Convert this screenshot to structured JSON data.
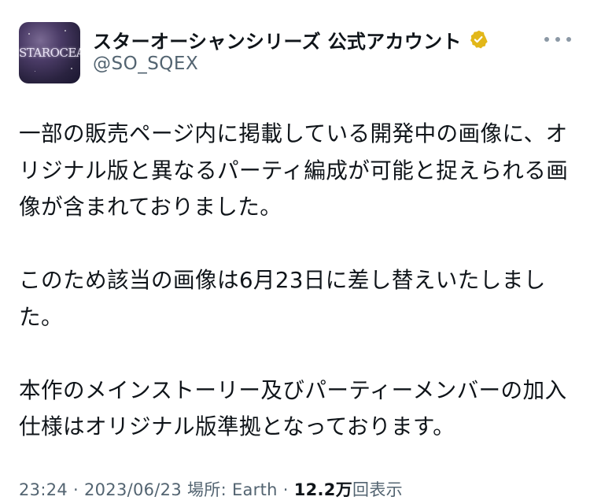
{
  "account": {
    "display_name": "スターオーシャンシリーズ 公式アカウント",
    "handle": "@SO_SQEX",
    "avatar_logo_text": "STAROCEAN",
    "verified_icon": "verified-badge-gold",
    "verified_color": "#e2b719"
  },
  "more_icon": "more-horizontal-icon",
  "tweet": {
    "paragraph_1": "一部の販売ページ内に掲載している開発中の画像に、オリジナル版と異なるパーティ編成が可能と捉えられる画像が含まれておりました。",
    "paragraph_2": "このため該当の画像は6月23日に差し替えいたしました。",
    "paragraph_3": "本作のメインストーリー及びパーティーメンバーの加入仕様はオリジナル版準拠となっております。"
  },
  "meta": {
    "time": "23:24",
    "sep1": " · ",
    "date": "2023/06/23",
    "location": " 場所: Earth",
    "sep2": " · ",
    "views_count": "12.2万",
    "views_label": "回表示"
  }
}
